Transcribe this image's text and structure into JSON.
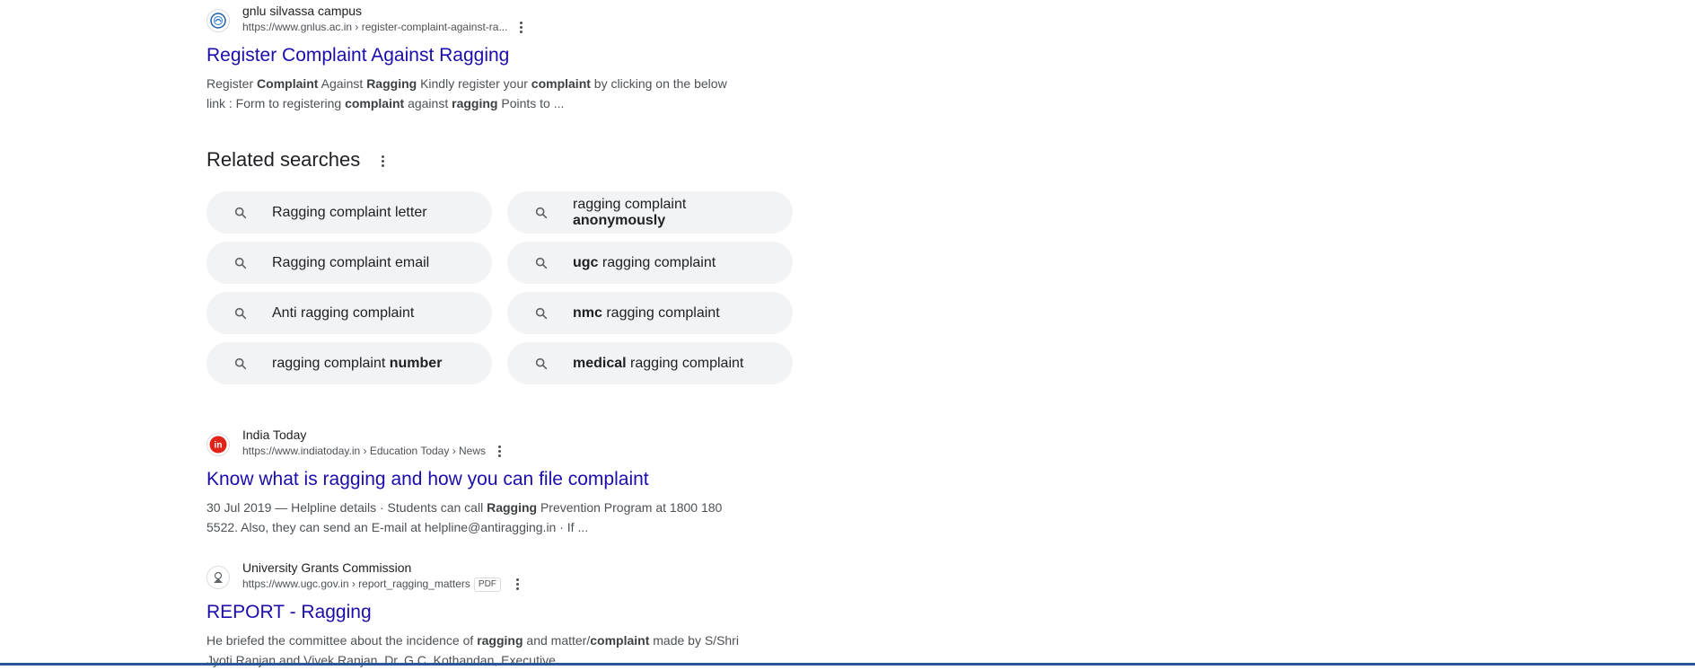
{
  "results": [
    {
      "site": "gnlu silvassa campus",
      "url": "https://www.gnlus.ac.in › register-complaint-against-ra...",
      "title": "Register Complaint Against Ragging",
      "snippet_parts": [
        {
          "t": "Register ",
          "b": false
        },
        {
          "t": "Complaint",
          "b": true
        },
        {
          "t": " Against ",
          "b": false
        },
        {
          "t": "Ragging",
          "b": true
        },
        {
          "t": " Kindly register your ",
          "b": false
        },
        {
          "t": "complaint",
          "b": true
        },
        {
          "t": " by clicking on the below link : Form to registering ",
          "b": false
        },
        {
          "t": "complaint",
          "b": true
        },
        {
          "t": " against ",
          "b": false
        },
        {
          "t": "ragging",
          "b": true
        },
        {
          "t": " Points to ...",
          "b": false
        }
      ]
    },
    {
      "site": "India Today",
      "url": "https://www.indiatoday.in › Education Today › News",
      "title": "Know what is ragging and how you can file complaint",
      "snippet_parts": [
        {
          "t": "30 Jul 2019 — Helpline details · Students can call ",
          "b": false
        },
        {
          "t": "Ragging",
          "b": true
        },
        {
          "t": " Prevention Program at 1800 180 5522. Also, they can send an E-mail at helpline@antiragging.in · If ...",
          "b": false
        }
      ]
    },
    {
      "site": "University Grants Commission",
      "url": "https://www.ugc.gov.in › report_ragging_matters",
      "badge": "PDF",
      "title": "REPORT - Ragging",
      "snippet_parts": [
        {
          "t": "He briefed the committee about the incidence of ",
          "b": false
        },
        {
          "t": "ragging",
          "b": true
        },
        {
          "t": " and matter/",
          "b": false
        },
        {
          "t": "complaint",
          "b": true
        },
        {
          "t": " made by S/Shri Jyoti Ranjan and Vivek Ranjan. Dr. G.C. Kothandan, Executive ...",
          "b": false
        }
      ]
    }
  ],
  "related": {
    "title": "Related searches",
    "chips": [
      {
        "parts": [
          {
            "t": "Ragging complaint letter",
            "b": false
          }
        ]
      },
      {
        "parts": [
          {
            "t": "ragging complaint ",
            "b": false
          },
          {
            "t": "anonymously",
            "b": true
          }
        ]
      },
      {
        "parts": [
          {
            "t": "Ragging complaint email",
            "b": false
          }
        ]
      },
      {
        "parts": [
          {
            "t": "ugc",
            "b": true
          },
          {
            "t": " ragging complaint",
            "b": false
          }
        ]
      },
      {
        "parts": [
          {
            "t": "Anti ragging complaint",
            "b": false
          }
        ]
      },
      {
        "parts": [
          {
            "t": "nmc",
            "b": true
          },
          {
            "t": " ragging complaint",
            "b": false
          }
        ]
      },
      {
        "parts": [
          {
            "t": "ragging complaint ",
            "b": false
          },
          {
            "t": "number",
            "b": true
          }
        ]
      },
      {
        "parts": [
          {
            "t": "medical",
            "b": true
          },
          {
            "t": " ragging complaint",
            "b": false
          }
        ]
      }
    ],
    "chip_icon": "search-icon"
  },
  "icons": {
    "more": "more-vert-icon",
    "gnlu_favicon": "gnlu-logo-icon",
    "indiatoday_favicon": "india-today-logo-icon",
    "ugc_favicon": "ugc-emblem-icon"
  },
  "colors": {
    "link": "#1a0dab",
    "chip_bg": "#f1f3f4",
    "india_today_red": "#e2231a",
    "taskbar": "#2b579a"
  }
}
